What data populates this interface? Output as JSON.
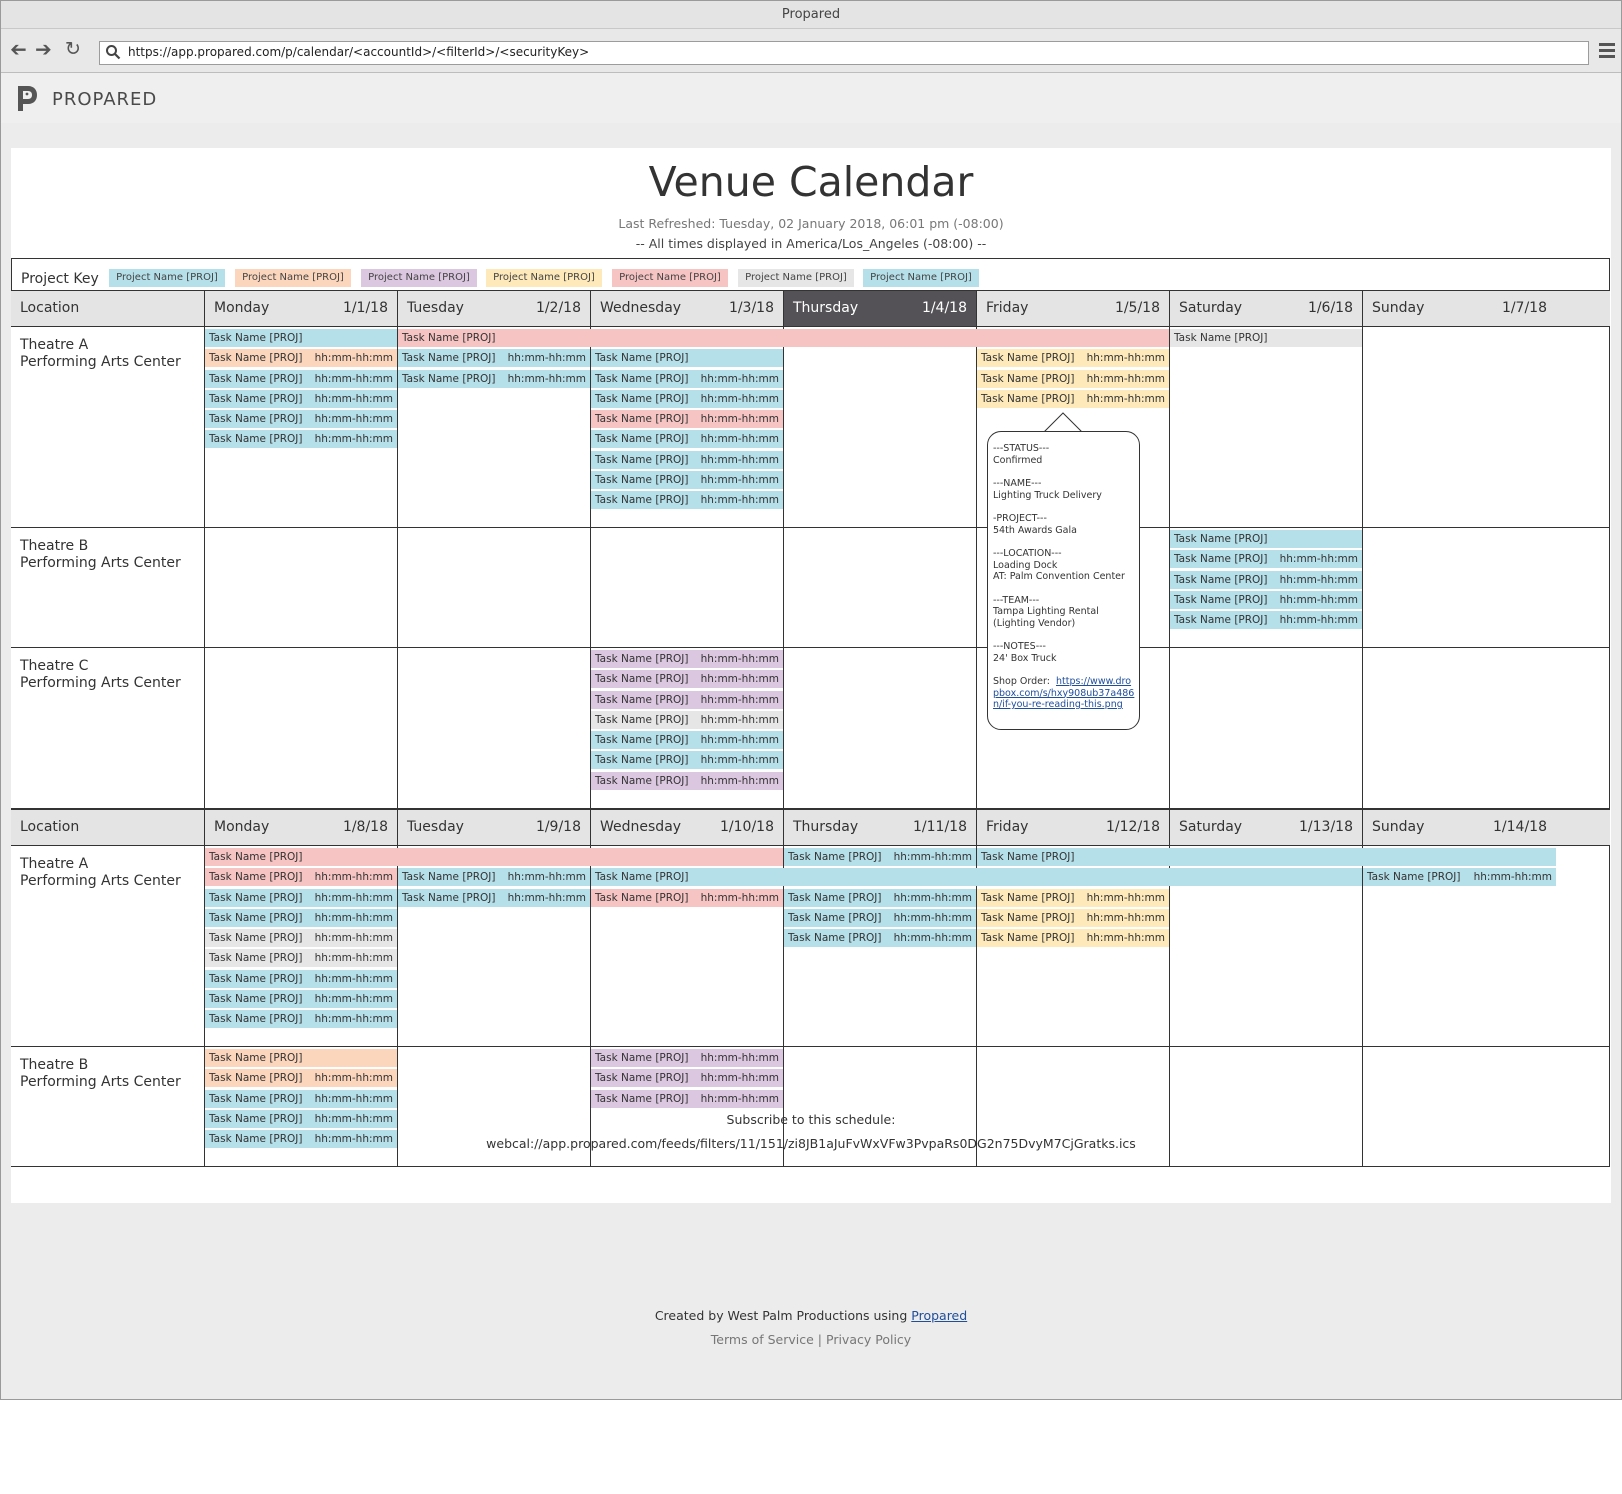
{
  "browser": {
    "window_title": "Propared",
    "url": "https://app.propared.com/p/calendar/<accountId>/<filterId>/<securityKey>"
  },
  "app": {
    "brand": "PROPARED"
  },
  "page": {
    "title": "Venue Calendar",
    "last_refreshed": "Last Refreshed: Tuesday, 02 January 2018, 06:01 pm (-08:00)",
    "timezone_note": "-- All times displayed in America/Los_Angeles (-08:00) --"
  },
  "project_key": {
    "label": "Project Key",
    "items": [
      {
        "label": "Project Name [PROJ]",
        "color": "#b5dfe9"
      },
      {
        "label": "Project Name [PROJ]",
        "color": "#fbd6bc"
      },
      {
        "label": "Project Name [PROJ]",
        "color": "#dcc7e0"
      },
      {
        "label": "Project Name [PROJ]",
        "color": "#fde9ba"
      },
      {
        "label": "Project Name [PROJ]",
        "color": "#f6c4c2"
      },
      {
        "label": "Project Name [PROJ]",
        "color": "#e6e6e6"
      },
      {
        "label": "Project Name [PROJ]",
        "color": "#b5dfe9"
      }
    ]
  },
  "weeks": [
    {
      "location_label": "Location",
      "today_index": 3,
      "days": [
        {
          "day": "Monday",
          "date": "1/1/18"
        },
        {
          "day": "Tuesday",
          "date": "1/2/18"
        },
        {
          "day": "Wednesday",
          "date": "1/3/18"
        },
        {
          "day": "Thursday",
          "date": "1/4/18"
        },
        {
          "day": "Friday",
          "date": "1/5/18"
        },
        {
          "day": "Saturday",
          "date": "1/6/18"
        },
        {
          "day": "Sunday",
          "date": "1/7/18"
        }
      ],
      "rows": [
        {
          "venue": "Theatre A",
          "place": "Performing Arts Center",
          "lines": 9,
          "tasks": [
            {
              "col": 0,
              "span": 1,
              "line": 0,
              "name": "Task Name [PROJ]",
              "time": "",
              "color": "blue"
            },
            {
              "col": 0,
              "span": 1,
              "line": 1,
              "name": "Task Name [PROJ]",
              "time": "hh:mm-hh:mm",
              "color": "peach"
            },
            {
              "col": 0,
              "span": 1,
              "line": 2,
              "name": "Task Name [PROJ]",
              "time": "hh:mm-hh:mm",
              "color": "blue"
            },
            {
              "col": 0,
              "span": 1,
              "line": 3,
              "name": "Task Name [PROJ]",
              "time": "hh:mm-hh:mm",
              "color": "blue"
            },
            {
              "col": 0,
              "span": 1,
              "line": 4,
              "name": "Task Name [PROJ]",
              "time": "hh:mm-hh:mm",
              "color": "blue"
            },
            {
              "col": 0,
              "span": 1,
              "line": 5,
              "name": "Task Name [PROJ]",
              "time": "hh:mm-hh:mm",
              "color": "blue"
            },
            {
              "col": 1,
              "span": 4,
              "line": 0,
              "name": "Task Name [PROJ]",
              "time": "",
              "color": "pink"
            },
            {
              "col": 1,
              "span": 1,
              "line": 1,
              "name": "Task Name [PROJ]",
              "time": "hh:mm-hh:mm",
              "color": "blue"
            },
            {
              "col": 1,
              "span": 1,
              "line": 2,
              "name": "Task Name [PROJ]",
              "time": "hh:mm-hh:mm",
              "color": "blue"
            },
            {
              "col": 2,
              "span": 1,
              "line": 1,
              "name": "Task Name [PROJ]",
              "time": "",
              "color": "blue"
            },
            {
              "col": 2,
              "span": 1,
              "line": 2,
              "name": "Task Name [PROJ]",
              "time": "hh:mm-hh:mm",
              "color": "blue"
            },
            {
              "col": 2,
              "span": 1,
              "line": 3,
              "name": "Task Name [PROJ]",
              "time": "hh:mm-hh:mm",
              "color": "blue"
            },
            {
              "col": 2,
              "span": 1,
              "line": 4,
              "name": "Task Name [PROJ]",
              "time": "hh:mm-hh:mm",
              "color": "pink"
            },
            {
              "col": 2,
              "span": 1,
              "line": 5,
              "name": "Task Name [PROJ]",
              "time": "hh:mm-hh:mm",
              "color": "blue"
            },
            {
              "col": 2,
              "span": 1,
              "line": 6,
              "name": "Task Name [PROJ]",
              "time": "hh:mm-hh:mm",
              "color": "blue"
            },
            {
              "col": 2,
              "span": 1,
              "line": 7,
              "name": "Task Name [PROJ]",
              "time": "hh:mm-hh:mm",
              "color": "blue"
            },
            {
              "col": 2,
              "span": 1,
              "line": 8,
              "name": "Task Name [PROJ]",
              "time": "hh:mm-hh:mm",
              "color": "blue"
            },
            {
              "col": 4,
              "span": 1,
              "line": 1,
              "name": "Task Name [PROJ]",
              "time": "hh:mm-hh:mm",
              "color": "yellow"
            },
            {
              "col": 4,
              "span": 1,
              "line": 2,
              "name": "Task Name [PROJ]",
              "time": "hh:mm-hh:mm",
              "color": "yellow"
            },
            {
              "col": 4,
              "span": 1,
              "line": 3,
              "name": "Task Name [PROJ]",
              "time": "hh:mm-hh:mm",
              "color": "yellow"
            },
            {
              "col": 5,
              "span": 1,
              "line": 0,
              "name": "Task Name [PROJ]",
              "time": "",
              "color": "grey"
            }
          ]
        },
        {
          "venue": "Theatre B",
          "place": "Performing Arts Center",
          "lines": 5,
          "tasks": [
            {
              "col": 5,
              "span": 1,
              "line": 0,
              "name": "Task Name [PROJ]",
              "time": "",
              "color": "blue"
            },
            {
              "col": 5,
              "span": 1,
              "line": 1,
              "name": "Task Name [PROJ]",
              "time": "hh:mm-hh:mm",
              "color": "blue"
            },
            {
              "col": 5,
              "span": 1,
              "line": 2,
              "name": "Task Name [PROJ]",
              "time": "hh:mm-hh:mm",
              "color": "blue"
            },
            {
              "col": 5,
              "span": 1,
              "line": 3,
              "name": "Task Name [PROJ]",
              "time": "hh:mm-hh:mm",
              "color": "blue"
            },
            {
              "col": 5,
              "span": 1,
              "line": 4,
              "name": "Task Name [PROJ]",
              "time": "hh:mm-hh:mm",
              "color": "blue"
            }
          ]
        },
        {
          "venue": "Theatre C",
          "place": "Performing Arts Center",
          "lines": 7,
          "tasks": [
            {
              "col": 2,
              "span": 1,
              "line": 0,
              "name": "Task Name [PROJ]",
              "time": "hh:mm-hh:mm",
              "color": "purple"
            },
            {
              "col": 2,
              "span": 1,
              "line": 1,
              "name": "Task Name [PROJ]",
              "time": "hh:mm-hh:mm",
              "color": "purple"
            },
            {
              "col": 2,
              "span": 1,
              "line": 2,
              "name": "Task Name [PROJ]",
              "time": "hh:mm-hh:mm",
              "color": "purple"
            },
            {
              "col": 2,
              "span": 1,
              "line": 3,
              "name": "Task Name [PROJ]",
              "time": "hh:mm-hh:mm",
              "color": "grey"
            },
            {
              "col": 2,
              "span": 1,
              "line": 4,
              "name": "Task Name [PROJ]",
              "time": "hh:mm-hh:mm",
              "color": "blue"
            },
            {
              "col": 2,
              "span": 1,
              "line": 5,
              "name": "Task Name [PROJ]",
              "time": "hh:mm-hh:mm",
              "color": "blue"
            },
            {
              "col": 2,
              "span": 1,
              "line": 6,
              "name": "Task Name [PROJ]",
              "time": "hh:mm-hh:mm",
              "color": "purple"
            }
          ]
        }
      ]
    },
    {
      "location_label": "Location",
      "today_index": -1,
      "days": [
        {
          "day": "Monday",
          "date": "1/8/18"
        },
        {
          "day": "Tuesday",
          "date": "1/9/18"
        },
        {
          "day": "Wednesday",
          "date": "1/10/18"
        },
        {
          "day": "Thursday",
          "date": "1/11/18"
        },
        {
          "day": "Friday",
          "date": "1/12/18"
        },
        {
          "day": "Saturday",
          "date": "1/13/18"
        },
        {
          "day": "Sunday",
          "date": "1/14/18"
        }
      ],
      "rows": [
        {
          "venue": "Theatre A",
          "place": "Performing Arts Center",
          "lines": 9,
          "tasks": [
            {
              "col": 0,
              "span": 3,
              "line": 0,
              "name": "Task Name [PROJ]",
              "time": "",
              "color": "pink"
            },
            {
              "col": 0,
              "span": 1,
              "line": 1,
              "name": "Task Name [PROJ]",
              "time": "hh:mm-hh:mm",
              "color": "pink"
            },
            {
              "col": 0,
              "span": 1,
              "line": 2,
              "name": "Task Name [PROJ]",
              "time": "hh:mm-hh:mm",
              "color": "blue"
            },
            {
              "col": 0,
              "span": 1,
              "line": 3,
              "name": "Task Name [PROJ]",
              "time": "hh:mm-hh:mm",
              "color": "blue"
            },
            {
              "col": 0,
              "span": 1,
              "line": 4,
              "name": "Task Name [PROJ]",
              "time": "hh:mm-hh:mm",
              "color": "grey"
            },
            {
              "col": 0,
              "span": 1,
              "line": 5,
              "name": "Task Name [PROJ]",
              "time": "hh:mm-hh:mm",
              "color": "grey"
            },
            {
              "col": 0,
              "span": 1,
              "line": 6,
              "name": "Task Name [PROJ]",
              "time": "hh:mm-hh:mm",
              "color": "blue"
            },
            {
              "col": 0,
              "span": 1,
              "line": 7,
              "name": "Task Name [PROJ]",
              "time": "hh:mm-hh:mm",
              "color": "blue"
            },
            {
              "col": 0,
              "span": 1,
              "line": 8,
              "name": "Task Name [PROJ]",
              "time": "hh:mm-hh:mm",
              "color": "blue"
            },
            {
              "col": 1,
              "span": 1,
              "line": 1,
              "name": "Task Name [PROJ]",
              "time": "hh:mm-hh:mm",
              "color": "blue"
            },
            {
              "col": 1,
              "span": 1,
              "line": 2,
              "name": "Task Name [PROJ]",
              "time": "hh:mm-hh:mm",
              "color": "blue"
            },
            {
              "col": 2,
              "span": 4,
              "line": 1,
              "name": "Task Name [PROJ]",
              "time": "",
              "color": "blue"
            },
            {
              "col": 2,
              "span": 1,
              "line": 2,
              "name": "Task Name [PROJ]",
              "time": "hh:mm-hh:mm",
              "color": "pink"
            },
            {
              "col": 3,
              "span": 1,
              "line": 0,
              "name": "Task Name [PROJ]",
              "time": "hh:mm-hh:mm",
              "color": "blue"
            },
            {
              "col": 3,
              "span": 1,
              "line": 2,
              "name": "Task Name [PROJ]",
              "time": "hh:mm-hh:mm",
              "color": "blue"
            },
            {
              "col": 3,
              "span": 1,
              "line": 3,
              "name": "Task Name [PROJ]",
              "time": "hh:mm-hh:mm",
              "color": "blue"
            },
            {
              "col": 3,
              "span": 1,
              "line": 4,
              "name": "Task Name [PROJ]",
              "time": "hh:mm-hh:mm",
              "color": "blue"
            },
            {
              "col": 4,
              "span": 3,
              "line": 0,
              "name": "Task Name [PROJ]",
              "time": "",
              "color": "blue"
            },
            {
              "col": 4,
              "span": 1,
              "line": 2,
              "name": "Task Name [PROJ]",
              "time": "hh:mm-hh:mm",
              "color": "yellow"
            },
            {
              "col": 4,
              "span": 1,
              "line": 3,
              "name": "Task Name [PROJ]",
              "time": "hh:mm-hh:mm",
              "color": "yellow"
            },
            {
              "col": 4,
              "span": 1,
              "line": 4,
              "name": "Task Name [PROJ]",
              "time": "hh:mm-hh:mm",
              "color": "yellow"
            },
            {
              "col": 6,
              "span": 1,
              "line": 1,
              "name": "Task Name [PROJ]",
              "time": "hh:mm-hh:mm",
              "color": "blue"
            }
          ]
        },
        {
          "venue": "Theatre B",
          "place": "Performing Arts Center",
          "lines": 5,
          "tasks": [
            {
              "col": 0,
              "span": 1,
              "line": 0,
              "name": "Task Name [PROJ]",
              "time": "",
              "color": "peach"
            },
            {
              "col": 0,
              "span": 1,
              "line": 1,
              "name": "Task Name [PROJ]",
              "time": "hh:mm-hh:mm",
              "color": "peach"
            },
            {
              "col": 0,
              "span": 1,
              "line": 2,
              "name": "Task Name [PROJ]",
              "time": "hh:mm-hh:mm",
              "color": "blue"
            },
            {
              "col": 0,
              "span": 1,
              "line": 3,
              "name": "Task Name [PROJ]",
              "time": "hh:mm-hh:mm",
              "color": "blue"
            },
            {
              "col": 0,
              "span": 1,
              "line": 4,
              "name": "Task Name [PROJ]",
              "time": "hh:mm-hh:mm",
              "color": "blue"
            },
            {
              "col": 2,
              "span": 1,
              "line": 0,
              "name": "Task Name [PROJ]",
              "time": "hh:mm-hh:mm",
              "color": "purple"
            },
            {
              "col": 2,
              "span": 1,
              "line": 1,
              "name": "Task Name [PROJ]",
              "time": "hh:mm-hh:mm",
              "color": "purple"
            },
            {
              "col": 2,
              "span": 1,
              "line": 2,
              "name": "Task Name [PROJ]",
              "time": "hh:mm-hh:mm",
              "color": "purple"
            }
          ]
        }
      ]
    }
  ],
  "popup": {
    "status_h": "---STATUS---",
    "status": "Confirmed",
    "name_h": "---NAME---",
    "name": "Lighting Truck Delivery",
    "project_h": "-PROJECT---",
    "project": "54th Awards Gala",
    "location_h": "---LOCATION---",
    "location_1": "Loading Dock",
    "location_2": "AT: Palm Convention Center",
    "team_h": "---TEAM---",
    "team_1": "Tampa Lighting Rental",
    "team_2": "(Lighting Vendor)",
    "notes_h": "---NOTES---",
    "notes": "24' Box Truck",
    "shop_order_label": "Shop Order:",
    "shop_order_link": "https://www.dropbox.com/s/hxy908ub37a486n/if-you-re-reading-this.png"
  },
  "subscribe": {
    "label": "Subscribe to this schedule:",
    "url": "webcal://app.propared.com/feeds/filters/11/151/zi8JB1aJuFvWxVFw3PvpaRs0DG2n75DvyM7CjGratks.ics"
  },
  "footer": {
    "created_by": "Created by West Palm Productions using",
    "propared_link": "Propared",
    "terms": "Terms of Service",
    "separator": "|",
    "privacy": "Privacy Policy"
  }
}
